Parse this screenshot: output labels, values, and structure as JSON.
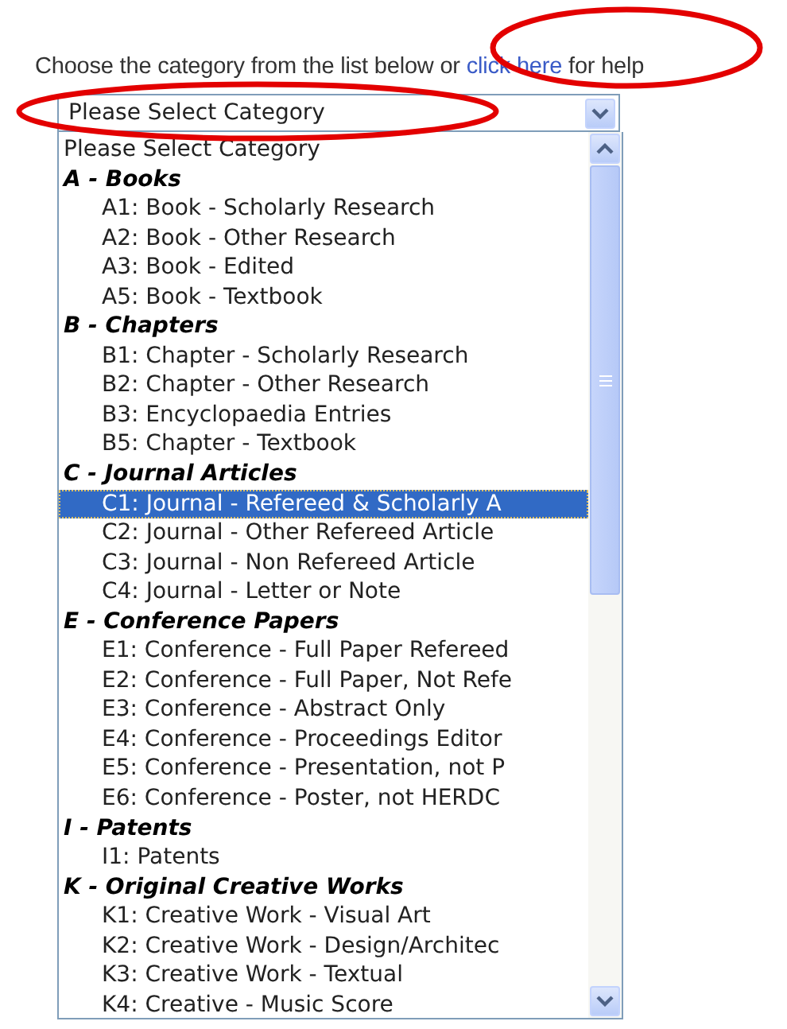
{
  "instruction": {
    "before": "Choose the category from the list below or ",
    "link": "click here",
    "after": " for help"
  },
  "dropdown": {
    "value": "Please Select Category",
    "expanded": true
  },
  "list": {
    "items": [
      {
        "label": "Please Select Category",
        "selected": false
      },
      {
        "label": "A - Books",
        "children": [
          {
            "label": "A1: Book - Scholarly Research",
            "selected": false
          },
          {
            "label": "A2: Book - Other Research",
            "selected": false
          },
          {
            "label": "A3: Book - Edited",
            "selected": false
          },
          {
            "label": "A5: Book - Textbook",
            "selected": false
          }
        ]
      },
      {
        "label": "B - Chapters",
        "children": [
          {
            "label": "B1: Chapter - Scholarly Research",
            "selected": false
          },
          {
            "label": "B2: Chapter - Other Research",
            "selected": false
          },
          {
            "label": "B3: Encyclopaedia Entries",
            "selected": false
          },
          {
            "label": "B5: Chapter - Textbook",
            "selected": false
          }
        ]
      },
      {
        "label": "C - Journal Articles",
        "children": [
          {
            "label": "C1: Journal - Refereed & Scholarly A",
            "selected": true
          },
          {
            "label": "C2: Journal - Other Refereed Article",
            "selected": false
          },
          {
            "label": "C3: Journal - Non Refereed Article",
            "selected": false
          },
          {
            "label": "C4: Journal - Letter or Note",
            "selected": false
          }
        ]
      },
      {
        "label": "E - Conference Papers",
        "children": [
          {
            "label": "E1: Conference - Full Paper Refereed",
            "selected": false
          },
          {
            "label": "E2: Conference - Full Paper, Not Refe",
            "selected": false
          },
          {
            "label": "E3: Conference - Abstract Only",
            "selected": false
          },
          {
            "label": "E4: Conference - Proceedings Editor",
            "selected": false
          },
          {
            "label": "E5: Conference - Presentation, not P",
            "selected": false
          },
          {
            "label": "E6: Conference - Poster, not HERDC",
            "selected": false
          }
        ]
      },
      {
        "label": "I - Patents",
        "children": [
          {
            "label": "I1: Patents",
            "selected": false
          }
        ]
      },
      {
        "label": "K - Original Creative Works",
        "children": [
          {
            "label": "K1: Creative Work - Visual Art",
            "selected": false
          },
          {
            "label": "K2: Creative Work - Design/Architec",
            "selected": false
          },
          {
            "label": "K3: Creative Work - Textual",
            "selected": false
          },
          {
            "label": "K4: Creative - Music Score",
            "selected": false
          }
        ]
      }
    ]
  },
  "annotations": [
    {
      "kind": "ellipse"
    },
    {
      "kind": "ellipse"
    }
  ]
}
